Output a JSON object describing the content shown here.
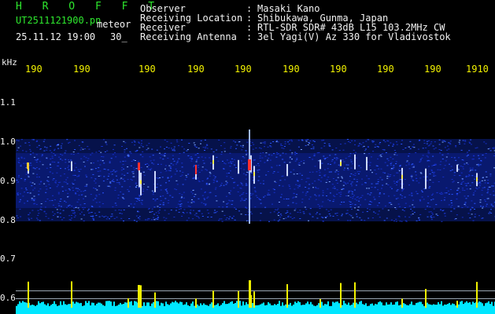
{
  "header": {
    "title": "H R O F F T",
    "filename": "UT2511121900.pn",
    "meteor_label": "meteor",
    "datetime": "25.11.12 19:00",
    "count": "30_"
  },
  "info": [
    {
      "label": "Observer",
      "sep": ":",
      "value": "Masaki Kano"
    },
    {
      "label": "Receiving Location",
      "sep": ":",
      "value": "Shibukawa, Gunma, Japan"
    },
    {
      "label": "Receiver",
      "sep": ":",
      "value": "RTL-SDR SDR# 43dB L15 103.2MHz CW"
    },
    {
      "label": "Receiving Antenna",
      "sep": ":",
      "value": "3el Yagi(V) Az 330 for Vladivostok"
    }
  ],
  "axis": {
    "unit": "kHz",
    "time_ticks": [
      "190",
      "190",
      "190",
      "190",
      "190",
      "190",
      "190",
      "190",
      "190",
      "1910"
    ],
    "freq_ticks": [
      "1.1",
      "1.0",
      "0.9",
      "0.8",
      "0.7",
      "0.6"
    ]
  },
  "colors": {
    "background": "#000000",
    "title": "#2ee82e",
    "axis_text": "#f2f200",
    "noise_band": "#1a3cff",
    "hot": "#ff3030",
    "spike": "#f2f200",
    "floor": "#00e6ff"
  }
}
